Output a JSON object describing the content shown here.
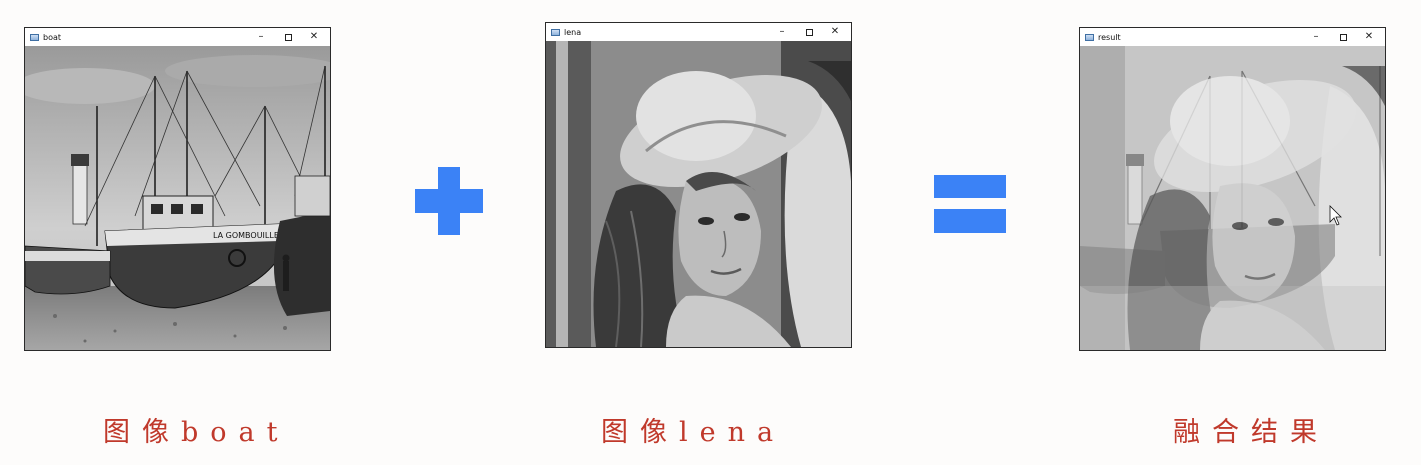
{
  "windows": [
    {
      "id": "boat",
      "title": "boat",
      "controls": {
        "minimize": "–",
        "close": "✕"
      }
    },
    {
      "id": "lena",
      "title": "lena",
      "controls": {
        "minimize": "–",
        "close": "✕"
      }
    },
    {
      "id": "result",
      "title": "result",
      "controls": {
        "minimize": "–",
        "close": "✕"
      }
    }
  ],
  "operators": {
    "plus": "plus-icon",
    "equals": "equals-icon",
    "color": "#3b82f6"
  },
  "captions": {
    "boat": "图像boat",
    "lena": "图像lena",
    "result": "融合结果",
    "color": "#c0392b"
  }
}
